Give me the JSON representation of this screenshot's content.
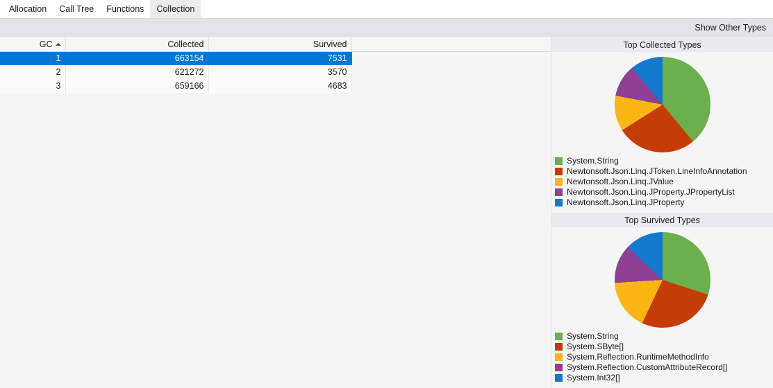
{
  "tabs": [
    {
      "label": "Allocation",
      "active": false
    },
    {
      "label": "Call Tree",
      "active": false
    },
    {
      "label": "Functions",
      "active": false
    },
    {
      "label": "Collection",
      "active": true
    }
  ],
  "toolbar": {
    "show_other_types_label": "Show Other Types"
  },
  "grid": {
    "columns": [
      {
        "label": "GC",
        "sorted": "asc",
        "sort_icon": "sort-ascending-icon"
      },
      {
        "label": "Collected",
        "sorted": "",
        "sort_icon": ""
      },
      {
        "label": "Survived",
        "sorted": "",
        "sort_icon": ""
      },
      {
        "label": "",
        "sorted": "",
        "sort_icon": ""
      }
    ],
    "rows": [
      {
        "gc": "1",
        "collected": "663154",
        "survived": "7531",
        "selected": true
      },
      {
        "gc": "2",
        "collected": "621272",
        "survived": "3570",
        "selected": false
      },
      {
        "gc": "3",
        "collected": "659166",
        "survived": "4683",
        "selected": false
      }
    ]
  },
  "palette": {
    "green": "#6cb04e",
    "red": "#c43d06",
    "yellow": "#fbb615",
    "purple": "#8e3f96",
    "blue": "#1379cc",
    "selection": "#0078d4"
  },
  "chart_data": [
    {
      "type": "pie",
      "title": "Top Collected Types",
      "legend_position": "bottom-left",
      "categories": [
        "System.String",
        "Newtonsoft.Json.Linq.JToken.LineInfoAnnotation",
        "Newtonsoft.Json.Linq.JValue",
        "Newtonsoft.Json.Linq.JProperty.JPropertyList",
        "Newtonsoft.Json.Linq.JProperty"
      ],
      "values": [
        39,
        27,
        12,
        11,
        11
      ],
      "colors": [
        "#6cb04e",
        "#c43d06",
        "#fbb615",
        "#8e3f96",
        "#1379cc"
      ]
    },
    {
      "type": "pie",
      "title": "Top Survived Types",
      "legend_position": "bottom-left",
      "categories": [
        "System.String",
        "System.SByte[]",
        "System.Reflection.RuntimeMethodInfo",
        "System.Reflection.CustomAttributeRecord[]",
        "System.Int32[]"
      ],
      "values": [
        30,
        27,
        17,
        13,
        13
      ],
      "colors": [
        "#6cb04e",
        "#c43d06",
        "#fbb615",
        "#8e3f96",
        "#1379cc"
      ]
    }
  ]
}
